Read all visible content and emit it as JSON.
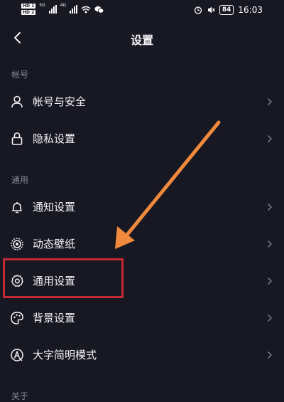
{
  "status_bar": {
    "sim1": "HD 1",
    "sim2": "HD 2",
    "network": "5G",
    "network2": "4G",
    "battery": "84",
    "time": "16:03"
  },
  "header": {
    "title": "设置"
  },
  "sections": [
    {
      "title": "帐号",
      "items": [
        {
          "label": "帐号与安全",
          "icon": "user-icon"
        },
        {
          "label": "隐私设置",
          "icon": "lock-icon"
        }
      ]
    },
    {
      "title": "通用",
      "items": [
        {
          "label": "通知设置",
          "icon": "bell-icon"
        },
        {
          "label": "动态壁纸",
          "icon": "live-wallpaper-icon"
        },
        {
          "label": "通用设置",
          "icon": "gear-icon"
        },
        {
          "label": "背景设置",
          "icon": "palette-icon"
        },
        {
          "label": "大字简明模式",
          "icon": "font-size-icon"
        }
      ]
    },
    {
      "title": "关于",
      "items": []
    }
  ],
  "colors": {
    "background": "#181823",
    "text": "#f2f2f5",
    "section_text": "#8a8a98",
    "highlight": "#c42a36",
    "arrow": "#f08a3c"
  }
}
